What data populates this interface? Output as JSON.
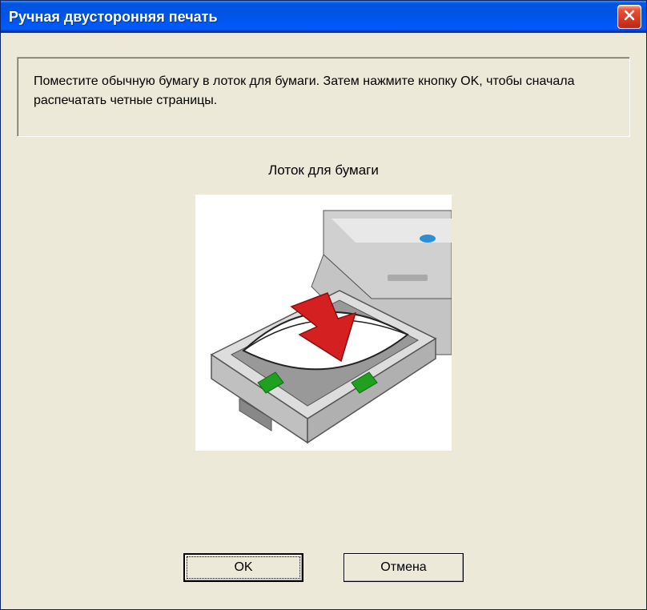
{
  "window": {
    "title": "Ручная двусторонняя печать"
  },
  "message": {
    "text": "Поместите обычную бумагу в лоток для бумаги. Затем нажмите кнопку OK, чтобы сначала распечатать четные страницы."
  },
  "illustration": {
    "caption": "Лоток для бумаги"
  },
  "buttons": {
    "ok": "OK",
    "cancel": "Отмена"
  }
}
